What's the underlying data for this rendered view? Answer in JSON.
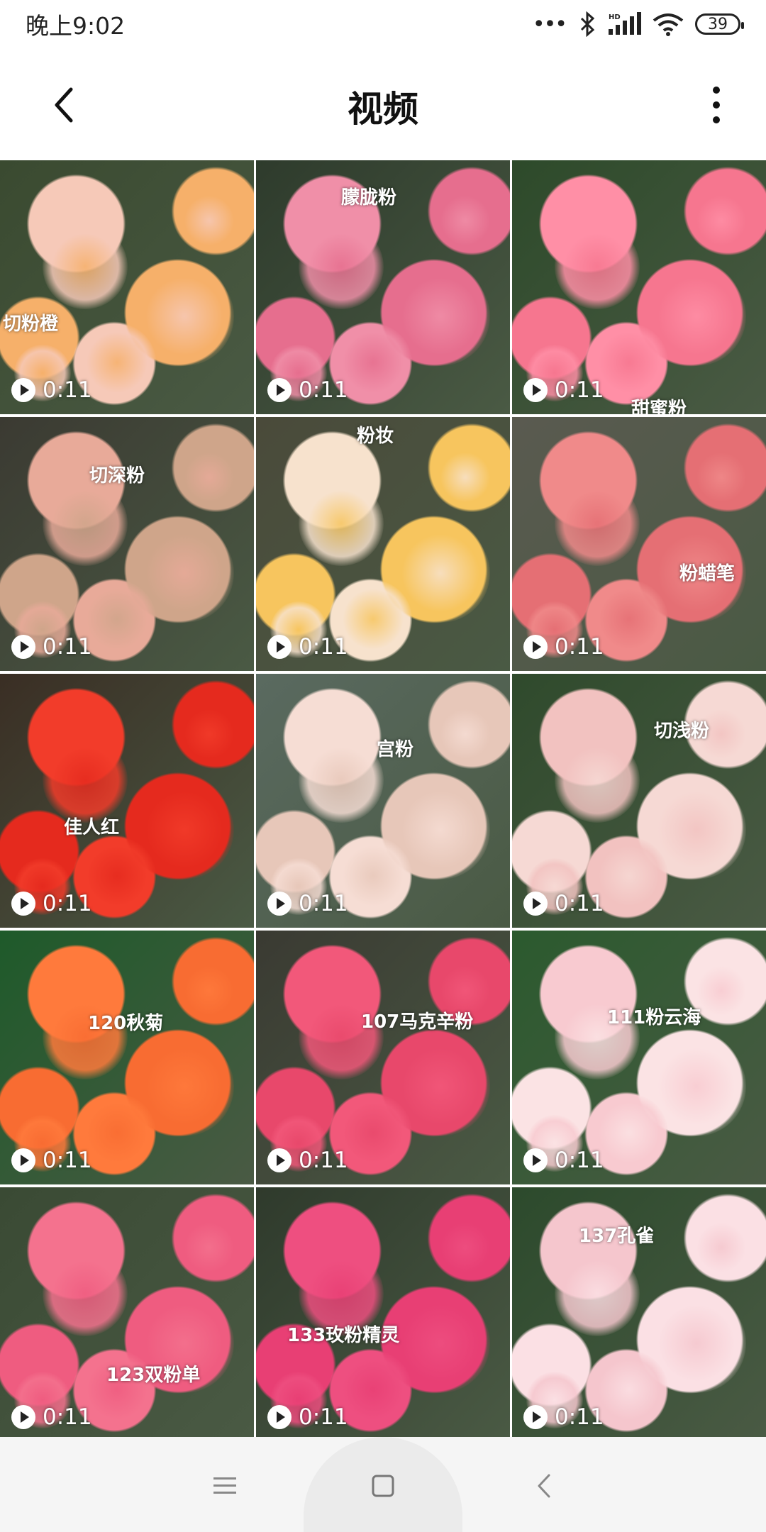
{
  "status_bar": {
    "time": "晚上9:02",
    "battery": "39",
    "network_badge": "HD"
  },
  "header": {
    "title": "视频"
  },
  "videos": [
    {
      "label": "切粉橙",
      "duration": "0:11",
      "palette": [
        "#f6c9b8",
        "#f6b06a",
        "#3a4a30"
      ]
    },
    {
      "label": "朦胧粉",
      "duration": "0:11",
      "palette": [
        "#f08fa8",
        "#e66e8e",
        "#2e3b2c"
      ]
    },
    {
      "label": "甜蜜粉",
      "duration": "0:11",
      "palette": [
        "#ff8fa6",
        "#f6768f",
        "#2d4a2a"
      ]
    },
    {
      "label": "切深粉",
      "duration": "0:11",
      "palette": [
        "#e8aa99",
        "#cfa58a",
        "#3b3a32"
      ]
    },
    {
      "label": "粉妆",
      "duration": "0:11",
      "palette": [
        "#f7e2cd",
        "#f7c55e",
        "#4a4a3a"
      ]
    },
    {
      "label": "粉蜡笔",
      "duration": "0:11",
      "palette": [
        "#f08a8a",
        "#e56f74",
        "#5a5a50"
      ]
    },
    {
      "label": "佳人红",
      "duration": "0:11",
      "palette": [
        "#f23c2a",
        "#e52a1e",
        "#3a2e24"
      ]
    },
    {
      "label": "宫粉",
      "duration": "0:11",
      "palette": [
        "#f6ddd4",
        "#e7c7b9",
        "#5a6a60"
      ]
    },
    {
      "label": "切浅粉",
      "duration": "0:11",
      "palette": [
        "#f2c2c0",
        "#f6d9d4",
        "#2f4a2c"
      ]
    },
    {
      "label": "120秋菊",
      "duration": "0:11",
      "palette": [
        "#ff7a3c",
        "#f86c32",
        "#1e5a2a"
      ]
    },
    {
      "label": "107马克辛粉",
      "duration": "0:11",
      "palette": [
        "#f2587a",
        "#e8486b",
        "#3a3a32"
      ]
    },
    {
      "label": "111粉云海",
      "duration": "0:11",
      "palette": [
        "#f8cad0",
        "#fbe3e4",
        "#2b5a2e"
      ]
    },
    {
      "label": "123双粉单",
      "duration": "0:11",
      "palette": [
        "#f4728e",
        "#ef5c80",
        "#3a4a34"
      ]
    },
    {
      "label": "133玫粉精灵",
      "duration": "0:11",
      "palette": [
        "#ee4f80",
        "#e83f74",
        "#2f3a2c"
      ]
    },
    {
      "label": "137孔雀",
      "duration": "0:11",
      "palette": [
        "#f5c6cd",
        "#fbe0e4",
        "#2c4a2c"
      ]
    }
  ]
}
